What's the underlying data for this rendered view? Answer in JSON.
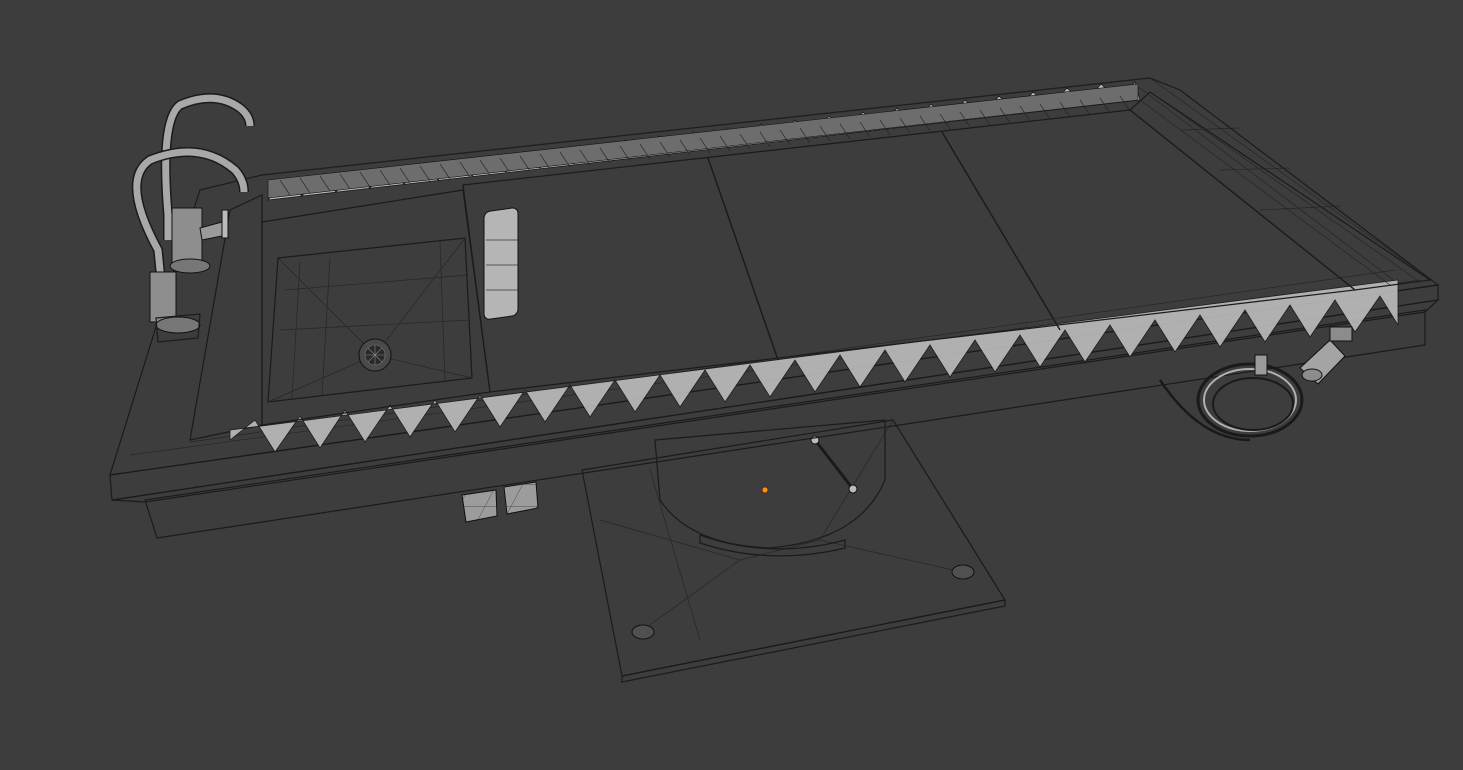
{
  "viewport": {
    "mode": "wireframe-overlay",
    "background_color": "#3d3d3d",
    "mesh_face_color": "#9a9a9a",
    "mesh_wire_color": "#222222",
    "origin_marker_color": "#ff8c1a"
  },
  "scene_object": {
    "name": "",
    "parts": [
      "table-top",
      "perforated-surface",
      "sink-basin",
      "drain",
      "faucet-primary",
      "faucet-secondary",
      "pedestal",
      "base-plate",
      "hose-reel",
      "control-buttons",
      "side-valve"
    ]
  }
}
